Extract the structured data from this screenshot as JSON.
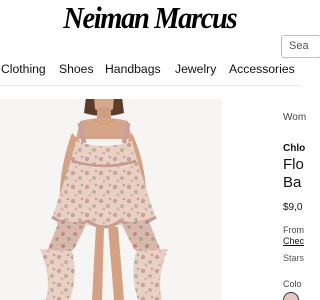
{
  "header": {
    "logo_text": "Neiman Marcus",
    "search_placeholder": "Sea"
  },
  "nav": {
    "items": [
      "Clothing",
      "Shoes",
      "Handbags",
      "Jewelry",
      "Accessories"
    ]
  },
  "product": {
    "image_icon": "dress-photo",
    "breadcrumb": "Wom",
    "designer": "Chlo",
    "title_line1": "Flo",
    "title_line2": "Ba",
    "price": "$9,0",
    "installments_prefix": "From",
    "checkout_link": "Chec",
    "rating_text": "Stars",
    "color_label": "Colo",
    "selected_color": "#e6c6bf"
  }
}
